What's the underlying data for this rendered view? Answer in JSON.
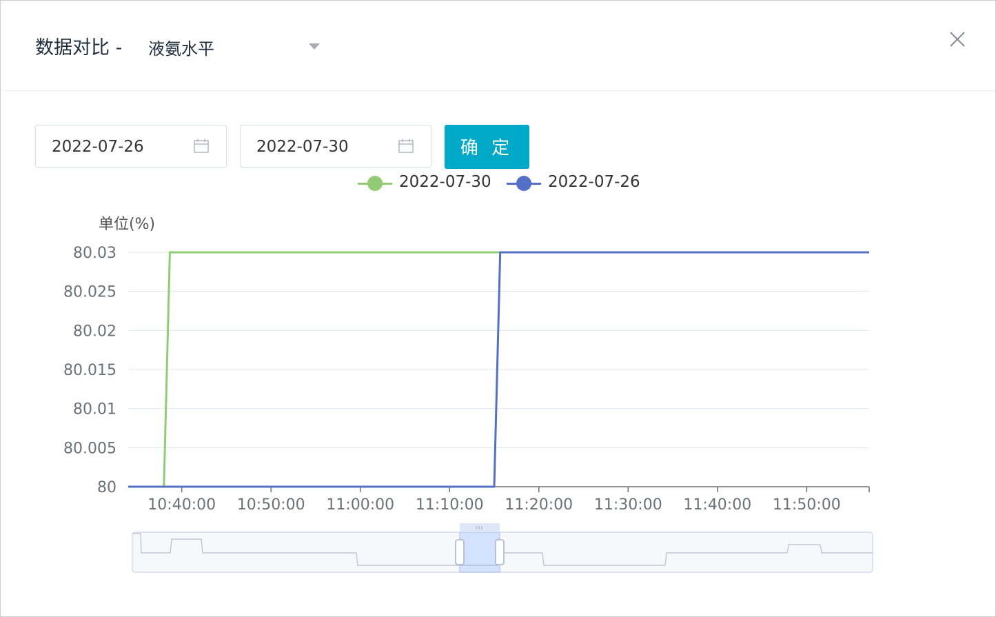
{
  "header": {
    "title": "数据对比 -",
    "selected_metric": "液氨水平"
  },
  "filters": {
    "start_date": "2022-07-26",
    "end_date": "2022-07-30",
    "confirm_label": "确 定"
  },
  "chart_data": {
    "type": "line",
    "ylabel": "单位(%)",
    "ylim": [
      80,
      80.03
    ],
    "yticks": [
      "80",
      "80.005",
      "80.01",
      "80.015",
      "80.02",
      "80.025",
      "80.03"
    ],
    "xticks": [
      "10:40:00",
      "10:50:00",
      "11:00:00",
      "11:10:00",
      "11:20:00",
      "11:30:00",
      "11:40:00",
      "11:50:00"
    ],
    "xlim": [
      "10:34:00",
      "11:57:00"
    ],
    "grid": true,
    "legend_position": "top-center",
    "series": [
      {
        "name": "2022-07-30",
        "color": "#91cc75",
        "points": [
          [
            "10:34:00",
            80
          ],
          [
            "10:38:00",
            80
          ],
          [
            "10:38:40",
            80.03
          ],
          [
            "11:57:00",
            80.03
          ]
        ]
      },
      {
        "name": "2022-07-26",
        "color": "#5470c6",
        "points": [
          [
            "10:34:00",
            80
          ],
          [
            "11:15:00",
            80
          ],
          [
            "11:15:40",
            80.03
          ],
          [
            "11:57:00",
            80.03
          ]
        ]
      }
    ]
  }
}
